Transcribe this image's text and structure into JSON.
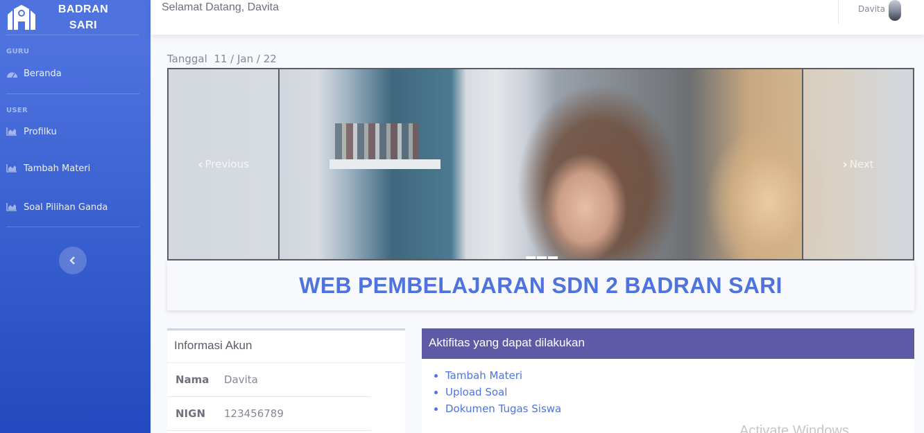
{
  "brand": {
    "line1": "BADRAN",
    "line2": "SARI"
  },
  "sidebar": {
    "heading_guru": "GURU",
    "heading_user": "USER",
    "items": [
      {
        "label": "Beranda",
        "icon": "dashboard-icon"
      },
      {
        "label": "Profilku",
        "icon": "chart-area-icon"
      },
      {
        "label": "Tambah Materi",
        "icon": "chart-area-icon"
      },
      {
        "label": "Soal Pilihan Ganda",
        "icon": "chart-area-icon"
      }
    ],
    "toggle_icon": "chevron-left-icon"
  },
  "topbar": {
    "welcome": "Selamat Datang, Davita",
    "user_name": "Davita"
  },
  "date": {
    "label": "Tanggal",
    "value": "11 / Jan / 22"
  },
  "carousel": {
    "prev_label": "Previous",
    "next_label": "Next",
    "slide_count": 3,
    "active_slide": 1
  },
  "banner": {
    "title": "WEB PEMBELAJARAN SDN 2 BADRAN SARI"
  },
  "info": {
    "title": "Informasi Akun",
    "rows": [
      {
        "key": "Nama",
        "value": "Davita"
      },
      {
        "key": "NIGN",
        "value": "123456789"
      }
    ]
  },
  "activities": {
    "title": "Aktifitas yang dapat dilakukan",
    "items": [
      "Tambah Materi",
      "Upload Soal",
      "Dokumen Tugas Siswa"
    ]
  },
  "watermark": "Activate Windows",
  "colors": {
    "primary": "#4e73df",
    "activity_header": "#5f5aa6"
  }
}
